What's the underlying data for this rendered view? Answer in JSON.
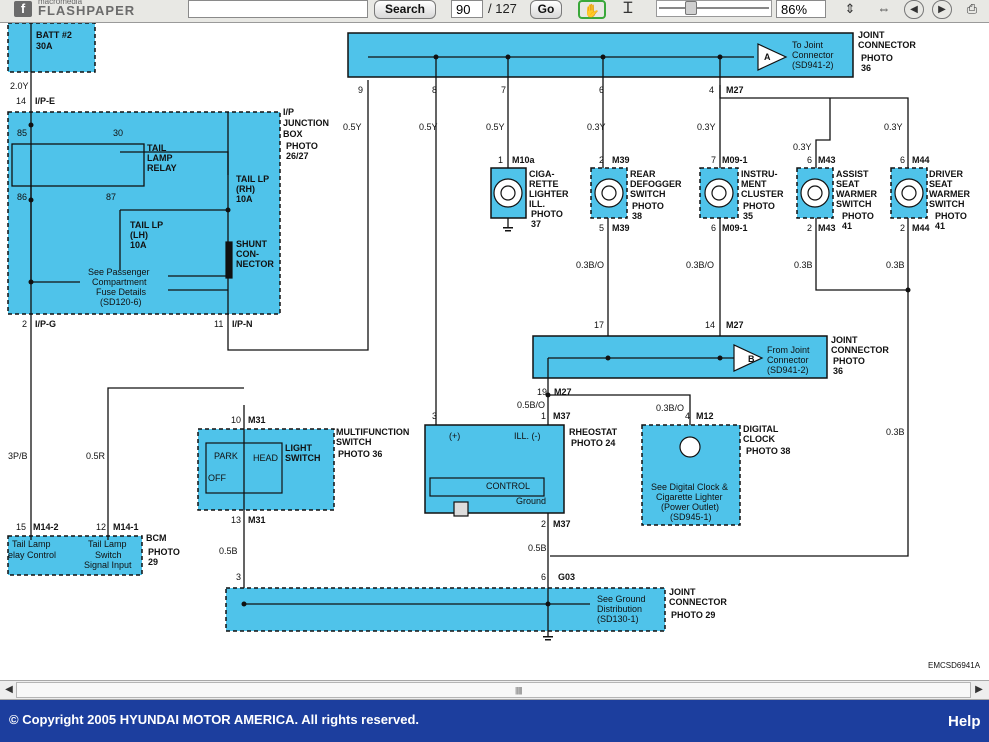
{
  "toolbar": {
    "logo_small": "macromedia",
    "logo_main": "FLASHPAPER",
    "search_value": "",
    "search_label": "Search",
    "page_current": "90",
    "page_total": "/ 127",
    "go_label": "Go",
    "zoom": "86%"
  },
  "diagram": {
    "code": "EMCSD6941A",
    "batt": {
      "name": "BATT #2",
      "amps": "30A"
    },
    "wire_20y": "2.0Y",
    "ip_junction": {
      "title": [
        "I/P",
        "JUNCTION",
        "BOX"
      ],
      "photo": [
        "PHOTO",
        "26/27"
      ]
    },
    "pins": {
      "p14": "14",
      "ipe": "I/P-E",
      "p85": "85",
      "p30": "30",
      "p86": "86",
      "p87": "87",
      "p2": "2",
      "ipg": "I/P-G",
      "p11": "11",
      "ipn": "I/P-N"
    },
    "tail_relay": [
      "TAIL",
      "LAMP",
      "RELAY"
    ],
    "tail_rh": [
      "TAIL LP",
      "(RH)",
      "10A"
    ],
    "tail_lh": [
      "TAIL LP",
      "(LH)",
      "10A"
    ],
    "shunt": [
      "SHUNT",
      "CON-",
      "NECTOR"
    ],
    "see_passenger": [
      "See Passenger",
      "Compartment",
      "Fuse Details",
      "(SD120-6)"
    ],
    "jc_top": {
      "pins": [
        "9",
        "8",
        "7",
        "6",
        "4"
      ],
      "m27": "M27",
      "letter": "A",
      "to": [
        "To Joint",
        "Connector",
        "(SD941-2)"
      ],
      "title": [
        "JOINT",
        "CONNECTOR"
      ],
      "photo": [
        "PHOTO",
        "36"
      ]
    },
    "wires_top": [
      "0.5Y",
      "0.5Y",
      "0.5Y",
      "0.3Y",
      "0.3Y",
      "0.3Y",
      "0.3Y"
    ],
    "cigar": {
      "pin": "1",
      "conn": "M10a",
      "label": [
        "CIGA-",
        "RETTE",
        "LIGHTER",
        "ILL."
      ],
      "photo": [
        "PHOTO",
        "37"
      ]
    },
    "rear_def": {
      "pin": "2",
      "conn": "M39",
      "label": [
        "REAR",
        "DEFOGGER",
        "SWITCH"
      ],
      "photo": [
        "PHOTO",
        "38"
      ],
      "pin_b": "5",
      "conn_b": "M39"
    },
    "cluster": {
      "pin": "7",
      "conn": "M09-1",
      "label": [
        "INSTRU-",
        "MENT",
        "CLUSTER"
      ],
      "photo": [
        "PHOTO",
        "35"
      ],
      "pin_b": "6",
      "conn_b": "M09-1"
    },
    "assist": {
      "pin": "6",
      "conn": "M43",
      "label": [
        "ASSIST",
        "SEAT",
        "WARMER",
        "SWITCH"
      ],
      "photo": [
        "PHOTO",
        "41"
      ],
      "pin_b": "2",
      "conn_b": "M43"
    },
    "driver": {
      "pin": "6",
      "conn": "M44",
      "label": [
        "DRIVER",
        "SEAT",
        "WARMER",
        "SWITCH"
      ],
      "photo": [
        "PHOTO",
        "41"
      ],
      "pin_b": "2",
      "conn_b": "M44"
    },
    "wires_mid": [
      "0.3B/O",
      "0.3B/O",
      "0.3B",
      "0.3B"
    ],
    "jc_b": {
      "p17": "17",
      "p14": "14",
      "m27": "M27",
      "letter": "B",
      "from": [
        "From Joint",
        "Connector",
        "(SD941-2)"
      ],
      "title": [
        "JOINT",
        "CONNECTOR"
      ],
      "photo": [
        "PHOTO",
        "36"
      ],
      "p19": "19",
      "m27b": "M27"
    },
    "wire_05bo": "0.5B/O",
    "wire_03bo": "0.3B/O",
    "wire_03b_right": "0.3B",
    "rheostat": {
      "p3": "3",
      "p1": "1",
      "m37": "M37",
      "title": "RHEOSTAT",
      "photo": "PHOTO 24",
      "plus": "(+)",
      "ill": "ILL. (-)",
      "control": "CONTROL",
      "ground": "Ground",
      "p2": "2",
      "m37b": "M37"
    },
    "digital_clock": {
      "p4": "4",
      "m12": "M12",
      "title": [
        "DIGITAL",
        "CLOCK"
      ],
      "photo": "PHOTO 38",
      "see": [
        "See Digital Clock &",
        "Cigarette Lighter",
        "(Power Outlet)",
        "(SD945-1)"
      ]
    },
    "multifunction": {
      "p10": "10",
      "m31": "M31",
      "title": [
        "MULTIFUNCTION",
        "SWITCH"
      ],
      "light": [
        "LIGHT",
        "SWITCH"
      ],
      "photo": "PHOTO 36",
      "park": "PARK",
      "head": "HEAD",
      "off": "OFF",
      "p13": "13",
      "m31b": "M31"
    },
    "wire_3pb": "3P/B",
    "wire_05r": "0.5R",
    "bcm": {
      "p15": "15",
      "m142": "M14-2",
      "p12": "12",
      "m141": "M14-1",
      "left": [
        "Tail Lamp",
        "elay Control"
      ],
      "right": [
        "Tail Lamp",
        "Switch",
        "Signal Input"
      ],
      "title": "BCM",
      "photo": [
        "PHOTO",
        "29"
      ]
    },
    "wire_05b_a": "0.5B",
    "wire_05b_b": "0.5B",
    "jc_g": {
      "p3": "3",
      "p6": "6",
      "g03": "G03",
      "see": [
        "See Ground",
        "Distribution",
        "(SD130-1)"
      ],
      "title": [
        "JOINT",
        "CONNECTOR"
      ],
      "photo": "PHOTO 29"
    }
  },
  "footer": {
    "copyright": "© Copyright 2005 HYUNDAI MOTOR AMERICA. All rights reserved.",
    "help": "Help"
  },
  "colors": {
    "panel": "#4fc3ea",
    "footer": "#1c3e9e",
    "toolbar": "#e8e8e4"
  }
}
